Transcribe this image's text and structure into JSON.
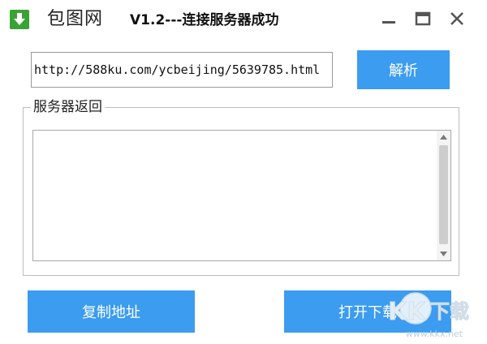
{
  "titlebar": {
    "app_name": "包图网",
    "status": "V1.2---连接服务器成功",
    "icon": "download-arrow-icon",
    "controls": {
      "minimize": "minimize-icon",
      "maximize": "maximize-icon",
      "close": "close-icon"
    }
  },
  "url_input": {
    "value": "http://588ku.com/ycbeijing/5639785.html"
  },
  "buttons": {
    "parse": "解析",
    "copy_address": "复制地址",
    "open_download": "打开下载"
  },
  "response_group": {
    "legend": "服务器返回",
    "content": ""
  },
  "watermark": {
    "logo_text": "KK下载",
    "url": "www.kkx.net"
  },
  "colors": {
    "accent": "#3b9cf0",
    "app_icon": "#3aa335"
  }
}
